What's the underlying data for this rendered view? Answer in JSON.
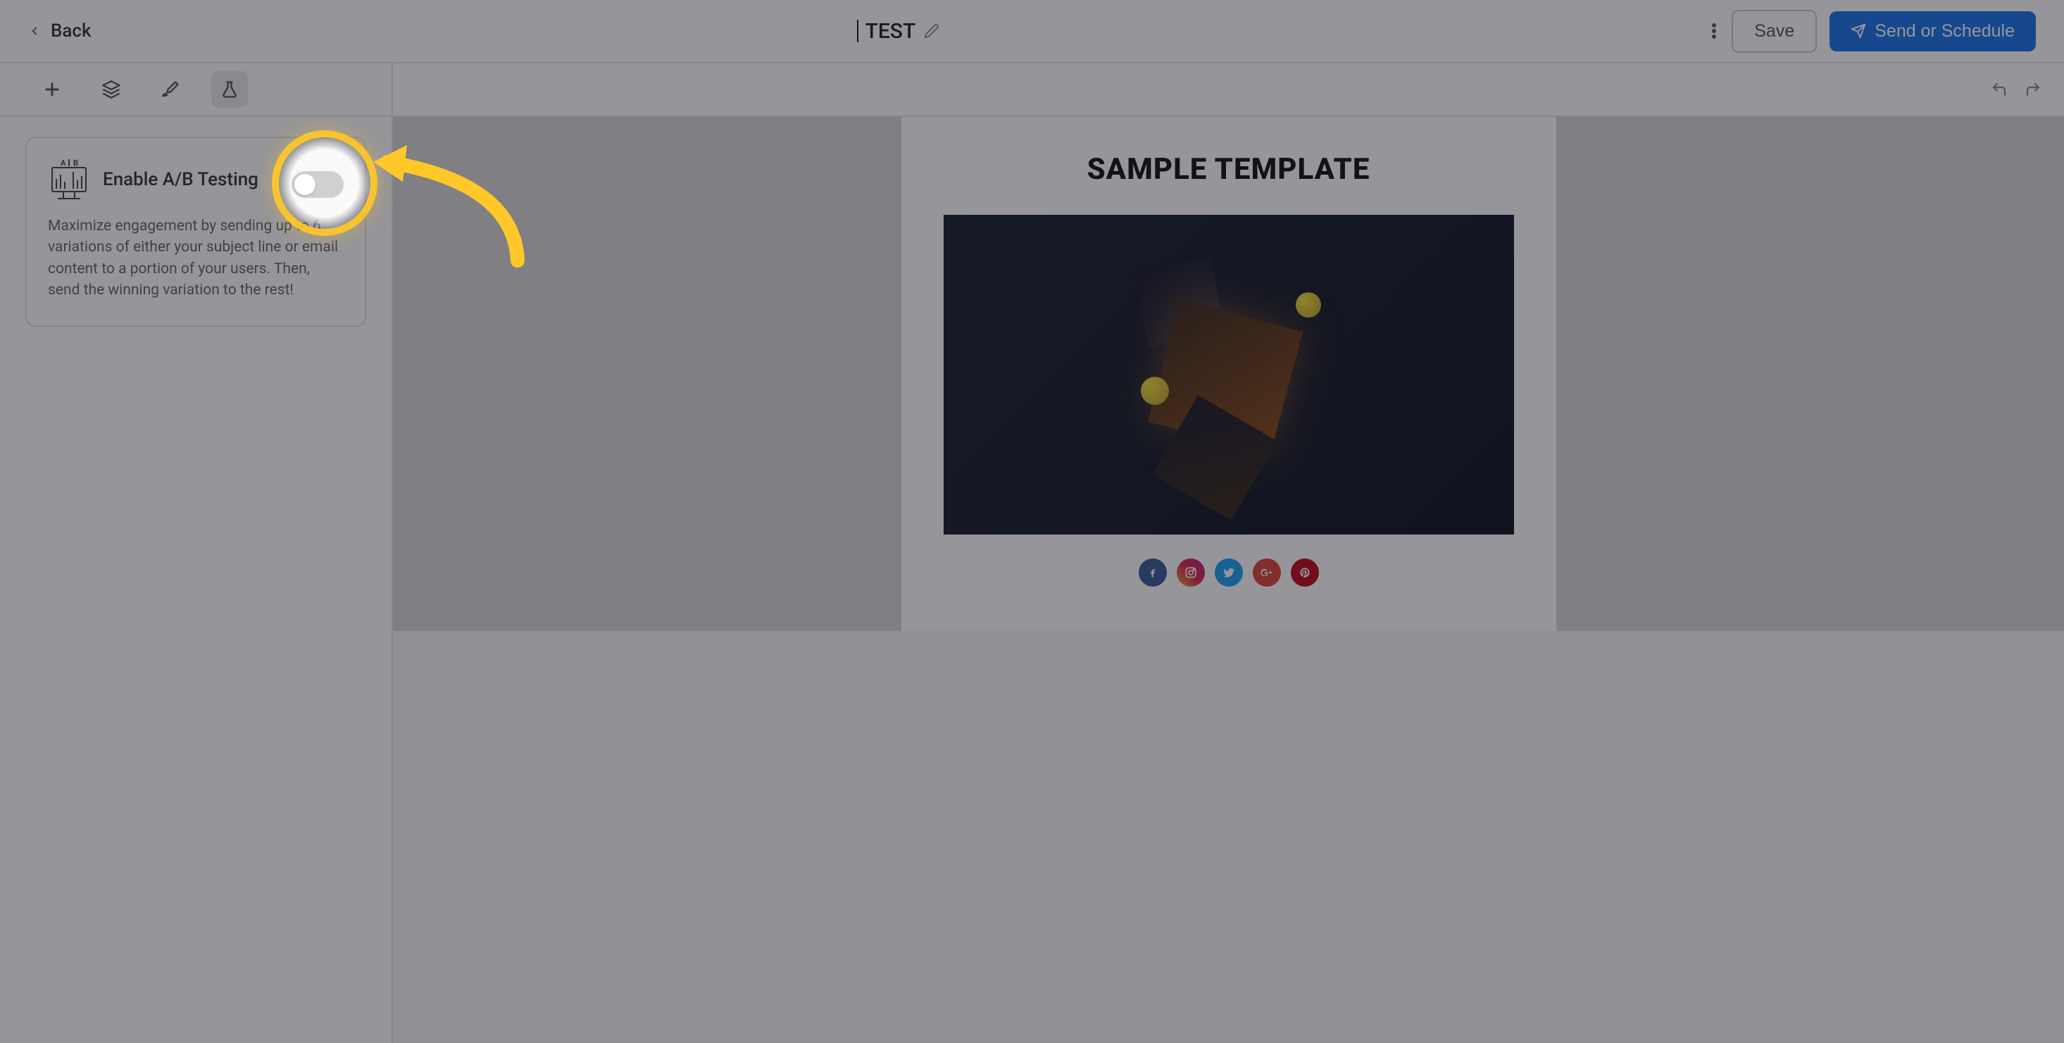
{
  "header": {
    "back_label": "Back",
    "title": "TEST",
    "save_label": "Save",
    "send_label": "Send or Schedule"
  },
  "sidebar": {
    "tools": [
      "add",
      "layers",
      "style",
      "ab-test"
    ],
    "ab_card": {
      "title": "Enable A/B Testing",
      "description": "Maximize engagement by sending up to 6 variations of either your subject line or email content to a portion of your users. Then, send the winning variation to the rest!",
      "toggle_on": false
    }
  },
  "canvas": {
    "email_title": "SAMPLE TEMPLATE",
    "social": [
      "facebook",
      "instagram",
      "twitter",
      "google-plus",
      "pinterest"
    ]
  },
  "annotation": {
    "type": "spotlight-arrow",
    "target": "ab-testing-toggle"
  },
  "colors": {
    "primary": "#1a73e8",
    "highlight": "#ffc828"
  }
}
